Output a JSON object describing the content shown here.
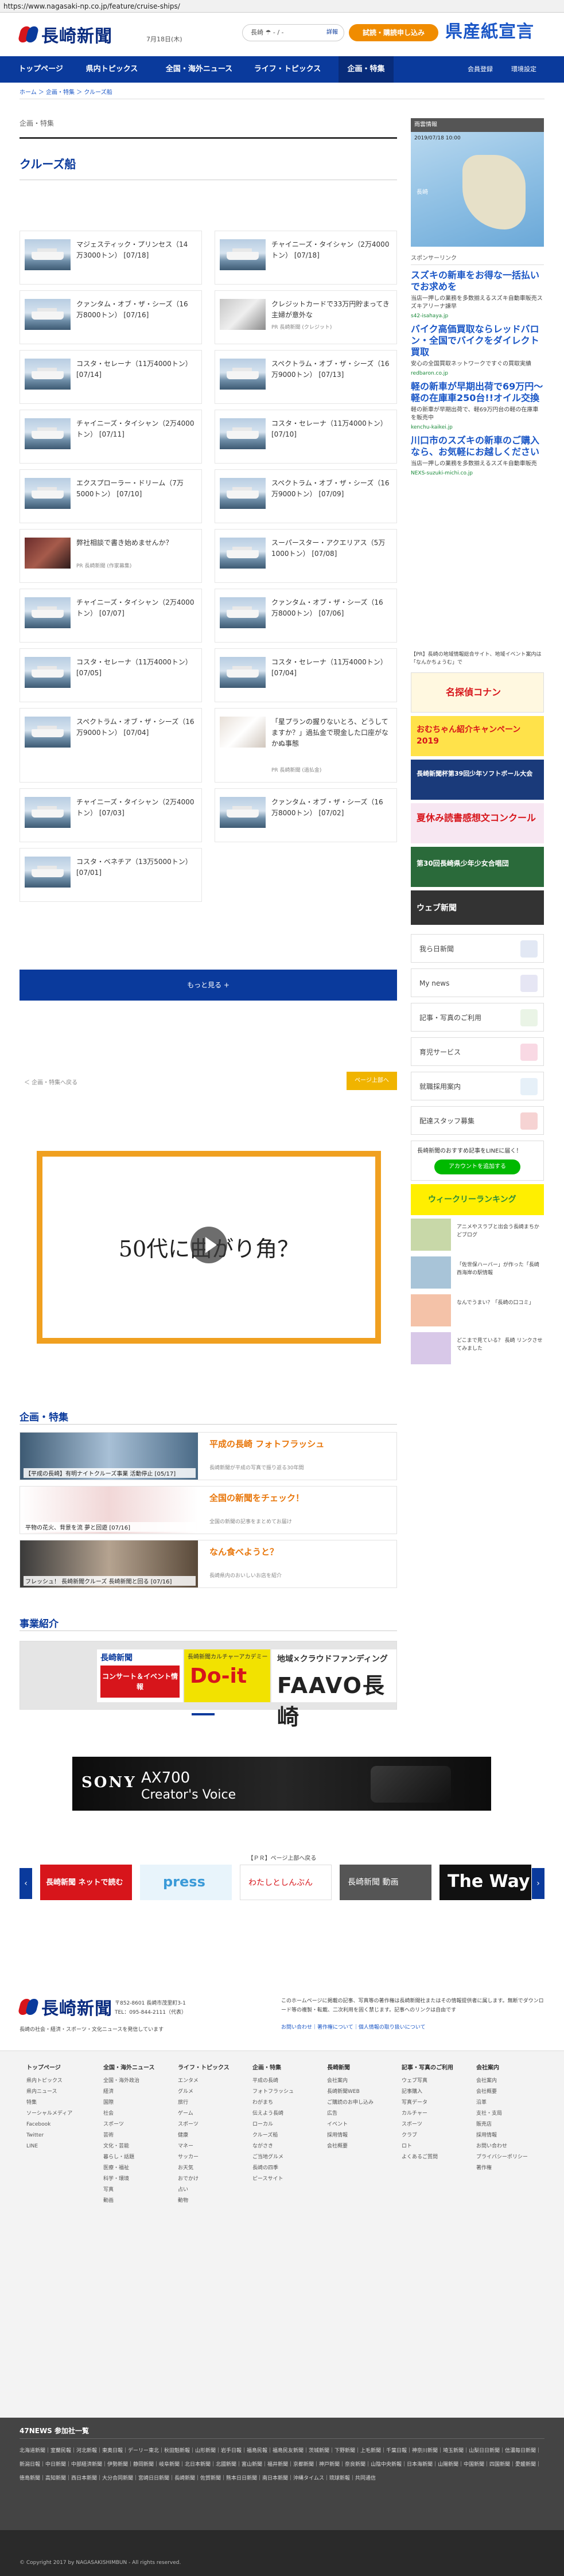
{
  "browser": {
    "url": "https://www.nagasaki-np.co.jp/feature/cruise-ships/"
  },
  "header": {
    "logo_text": "長崎新聞",
    "date": "7月18日(木)",
    "weather_label": "長崎",
    "weather_temp": "- / -",
    "weather_link": "詳報",
    "subscribe_label": "試読・購読申し込み",
    "ad_text": "県産紙宣言"
  },
  "nav": {
    "items": [
      "トップページ",
      "県内トピックス",
      "全国・海外ニュース",
      "ライフ・トピックス",
      "企画・特集"
    ],
    "login": "会員登録",
    "settings": "環境設定"
  },
  "breadcrumb": "ホーム ＞ 企画・特集 ＞ クルーズ船",
  "main": {
    "section_label": "企画・特集",
    "title": "クルーズ船",
    "cards": [
      {
        "text": "マジェスティック・プリンセス（14万3000トン） [07/18]"
      },
      {
        "text": "チャイニーズ・タイシャン（2万4000トン） [07/18]"
      },
      {
        "text": "クァンタム・オブ・ザ・シーズ（16万8000トン） [07/16]"
      },
      {
        "text": "クレジットカードで33万円貯まってき主婦が意外な"
      },
      {
        "text": "コスタ・セレーナ（11万4000トン） [07/14]"
      },
      {
        "text": "スペクトラム・オブ・ザ・シーズ（16万9000トン） [07/13]"
      },
      {
        "text": "チャイニーズ・タイシャン（2万4000トン） [07/11]"
      },
      {
        "text": "コスタ・セレーナ（11万4000トン） [07/10]"
      },
      {
        "text": "エクスプローラー・ドリーム（7万5000トン） [07/10]"
      },
      {
        "text": "スペクトラム・オブ・ザ・シーズ（16万9000トン） [07/09]"
      },
      {
        "text": "弊社相談で書き始めませんか？"
      },
      {
        "text": "スーパースター・アクエリアス（5万1000トン） [07/08]"
      },
      {
        "text": "チャイニーズ・タイシャン（2万4000トン） [07/07]"
      },
      {
        "text": "クァンタム・オブ・ザ・シーズ（16万8000トン） [07/06]"
      },
      {
        "text": "コスタ・セレーナ（11万4000トン） [07/05]"
      },
      {
        "text": "コスタ・セレーナ（11万4000トン） [07/04]"
      },
      {
        "text": "スペクトラム・オブ・ザ・シーズ（16万9000トン） [07/04]"
      },
      {
        "text": "「星プランの握りないとろ、どうしてますか？」過払金で現金した口座がなかぬ事態"
      },
      {
        "text": "チャイニーズ・タイシャン（2万4000トン） [07/03]"
      },
      {
        "text": "クァンタム・オブ・ザ・シーズ（16万8000トン） [07/02]"
      },
      {
        "text": "コスタ・ベネチア（13万5000トン） [07/01]"
      }
    ],
    "pr_labels": [
      "PR 長崎新聞 (クレジット)",
      "PR 長崎新聞 (作家募集)",
      "PR 長崎新聞 (過払金)"
    ],
    "more_label": "もっと見る +",
    "back_label": "＜ 企画・特集へ戻る",
    "pagetop_label": "ページ上部へ",
    "video_text": "50代に曲がり角？"
  },
  "tokushu": {
    "title": "企画・特集",
    "items": [
      {
        "caption": "【平成の長崎】有明ナイトクルーズ事業 活動停止 [05/17]",
        "head": "平成の長崎 フォトフラッシュ",
        "desc": "長崎新聞が平成の写真で振り返る30年間"
      },
      {
        "caption": "平物の花火、背景を流 夢と回遊 [07/16]",
        "head": "全国の新聞をチェック！",
        "desc": "全国の新聞の記事をまとめてお届け"
      },
      {
        "caption": "フレッシュ！ 長崎新聞クルーズ 長崎新聞と回る [07/16]",
        "head": "なん食べようと？",
        "desc": "長崎県内のおいしいお店を紹介"
      }
    ]
  },
  "business": {
    "title": "事業紹介",
    "b1_title": "長崎新聞",
    "b1_text": "コンサート＆イベント情報",
    "b2_title": "長崎新聞カルチャーアカデミー",
    "b2_big": "Do-it",
    "b3_title": "地域×クラウドファンディング",
    "b3_big": "FAAVO長崎"
  },
  "sidebar": {
    "radar_header": "雨雲情報",
    "radar_caption": "2019/07/18 10:00",
    "radar_label": "長崎",
    "sponsor_header": "スポンサーリンク",
    "sponsors": [
      {
        "title": "スズキの新車をお得な一括払いでお求めを",
        "desc": "当店一押しの業務を多数揃えるスズキ自動車販売スズキアリーナ諫早",
        "url": "s42-isahaya.jp"
      },
      {
        "title": "バイク高価買取ならレッドバロン・全国でバイクをダイレクト買取",
        "desc": "安心の全国買取ネットワークですぐの買取実績",
        "url": "redbaron.co.jp"
      },
      {
        "title": "軽の新車が早期出荷で69万円〜 軽の在庫車250台!!オイル交換",
        "desc": "軽の新車が早期出荷で、軽69万円台の軽の在庫車を販売中",
        "url": "kenchu-kaikei.jp"
      },
      {
        "title": "川口市のスズキの新車のご購入なら、お気軽にお越しください",
        "desc": "当店一押しの業務を多数揃えるスズキ自動車販売",
        "url": "NEXS-suzuki-michi.co.jp"
      }
    ],
    "info_text": "【PR】長崎の地域情報総合サイト、地域イベント案内は「なんかちょうむ」で",
    "banners": [
      "名探偵コナン",
      "おむちゃん紹介キャンペーン 2019",
      "長崎新聞杯第39回少年ソフトボール大会",
      "夏休み読書感想文コンクール",
      "第30回長崎県少年少女合唱団",
      "ウェブ新聞"
    ],
    "buttons": [
      "我ら日新聞",
      "My news",
      "記事・写真のご利用",
      "育児サービス",
      "就職採用案内",
      "配達スタッフ募集"
    ],
    "line_text": "長崎新聞のおすすめ記事をLINEに届く！",
    "line_btn": "アカウントを追加する",
    "weekly": "ウィークリーランキング",
    "mini": [
      {
        "text": "アニメやスラブと出会う長崎まちかどブログ"
      },
      {
        "text": "「佐世保ハーバー」が作った「長崎西海岸の駅情報"
      },
      {
        "text": "なんでうまい？「長崎の口コミ」"
      },
      {
        "text": "どこまで見ている？ 長崎 リンクさせてみました"
      }
    ]
  },
  "ads": {
    "sony_logo": "SONY",
    "sony_t1": "AX700",
    "sony_t2": "Creator's Voice"
  },
  "carousel": {
    "label": "【ＰＲ】ページ上部へ戻る",
    "items": [
      "長崎新聞 ネットで読む",
      "press",
      "わたしとしんぶん",
      "長崎新聞 動画",
      "The Way"
    ]
  },
  "footer": {
    "contact1": "〒852-8601 長崎市茂里町3-1",
    "contact2": "TEL：095-844-2111（代表）",
    "desc": "長崎の社会・経済・スポーツ・文化ニュースを発信しています",
    "copy": "このホームページに掲載の記事、写真等の著作権は長崎新聞社またはその情報提供者に属します。無断でダウンロード等の複製・転載、二次利用を固く禁じます。記事へのリンクは自由です",
    "links": "お問い合わせ｜著作権について｜個人情報の取り扱いについて"
  },
  "sitemap": {
    "cols": [
      {
        "hd": "トップページ",
        "items": [
          "県内トピックス",
          "県内ニュース",
          "特集",
          "ソーシャルメディア",
          "Facebook",
          "Twitter",
          "LINE"
        ]
      },
      {
        "hd": "全国・海外ニュース",
        "items": [
          "全国・海外政治",
          "経済",
          "国際",
          "社会",
          "スポーツ",
          "芸術",
          "文化・芸能",
          "暮らし・話題",
          "医療・福祉",
          "科学・環境",
          "写真",
          "動画"
        ]
      },
      {
        "hd": "ライフ・トピックス",
        "items": [
          "エンタメ",
          "グルメ",
          "旅行",
          "ゲーム",
          "スポーツ",
          "健康",
          "マネー",
          "サッカー",
          "お天気",
          "おでかけ",
          "占い",
          "動物"
        ]
      },
      {
        "hd": "企画・特集",
        "items": [
          "平成の長崎",
          "フォトフラッシュ",
          "わがまち",
          "伝えよう長崎",
          "ローカル",
          "クルーズ船",
          "ながさき",
          "ご当地グルメ",
          "長崎の四季",
          "ピースサイト"
        ]
      },
      {
        "hd": "長崎新聞",
        "items": [
          "会社案内",
          "長崎新聞WEB",
          "ご購読のお申し込み",
          "広告",
          "イベント",
          "採用情報",
          "会社概要"
        ]
      },
      {
        "hd": "記事・写真のご利用",
        "items": [
          "ウェブ写真",
          "記事購入",
          "写真データ",
          "カルチャー",
          "スポーツ",
          "クラブ",
          "ロト",
          "よくあるご質問"
        ]
      },
      {
        "hd": "会社案内",
        "items": [
          "会社案内",
          "会社概要",
          "沿革",
          "支社・支局",
          "販売店",
          "採用情報",
          "お問い合わせ",
          "プライバシーポリシー",
          "著作権"
        ]
      }
    ]
  },
  "news47": {
    "title": "47NEWS 参加社一覧",
    "list": "北海道新聞｜室蘭民報｜河北新報｜東奥日報｜デーリー東北｜秋田魁新報｜山形新聞｜岩手日報｜福島民報｜福島民友新聞｜茨城新聞｜下野新聞｜上毛新聞｜千葉日報｜神奈川新聞｜埼玉新聞｜山梨日日新聞｜信濃毎日新聞｜新潟日報｜中日新聞｜中部経済新聞｜伊勢新聞｜静岡新聞｜岐阜新聞｜北日本新聞｜北國新聞｜富山新聞｜福井新聞｜京都新聞｜神戸新聞｜奈良新聞｜山陰中央新報｜日本海新聞｜山陽新聞｜中国新聞｜四国新聞｜愛媛新聞｜徳島新聞｜高知新聞｜西日本新聞｜大分合同新聞｜宮崎日日新聞｜長崎新聞｜佐賀新聞｜熊本日日新聞｜南日本新聞｜沖縄タイムス｜琉球新報｜共同通信"
  },
  "copyright": "© Copyright 2017 by NAGASAKISHIMBUN - All rights reserved."
}
